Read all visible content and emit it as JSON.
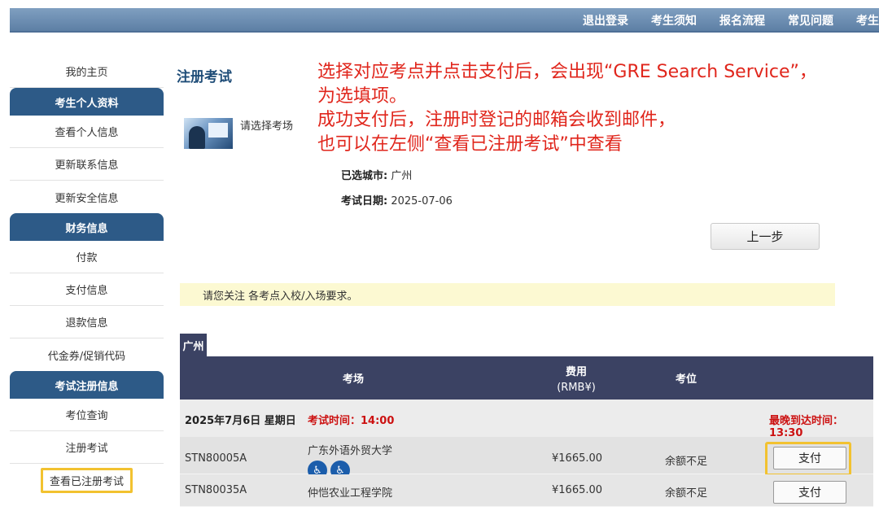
{
  "top_nav": [
    "退出登录",
    "考生须知",
    "报名流程",
    "常见问题",
    "考生"
  ],
  "sidebar": {
    "home": "我的主页",
    "sections": [
      {
        "title": "考生个人资料",
        "items": [
          "查看个人信息",
          "更新联系信息",
          "更新安全信息"
        ]
      },
      {
        "title": "财务信息",
        "items": [
          "付款",
          "支付信息",
          "退款信息",
          "代金券/促销代码"
        ]
      },
      {
        "title": "考试注册信息",
        "items": [
          "考位查询",
          "注册考试",
          "查看已注册考试"
        ]
      }
    ]
  },
  "main": {
    "title": "注册考试",
    "annotation": [
      "选择对应考点并点击支付后，会出现“GRE Search Service”，",
      "为选填项。",
      "成功支付后，注册时登记的邮箱会收到邮件，",
      "也可以在左侧“查看已注册考试”中查看"
    ],
    "choose_label": "请选择考场",
    "city_label": "已选城市:",
    "city_value": "广州",
    "date_label": "考试日期:",
    "date_value": "2025-07-06",
    "prev_button": "上一步",
    "notice": "请您关注 各考点入校/入场要求。",
    "city_tab": "广州"
  },
  "table": {
    "headers": {
      "venue": "考场",
      "fee": "费用",
      "fee_unit": "(RMB¥)",
      "seat": "考位"
    },
    "date_row": {
      "date": "2025年7月6日 星期日",
      "exam_time": "考试时间：14:00",
      "latest_arrival": "最晚到达时间：13:30"
    },
    "rows": [
      {
        "code": "STN80005A",
        "name": "广东外语外贸大学",
        "fee": "¥1665.00",
        "seat": "余额不足",
        "action": "支付",
        "icons": [
          "wheelchair-access-icon",
          "accessible-icon"
        ]
      },
      {
        "code": "STN80035A",
        "name": "仲恺农业工程学院",
        "fee": "¥1665.00",
        "seat": "余额不足",
        "action": "支付"
      }
    ]
  },
  "colors": {
    "nav": "#5d7fa5",
    "sidebar_head": "#2d5a87",
    "table_head": "#3b4263",
    "annotation": "#e0261c",
    "highlight": "#f2c230"
  }
}
